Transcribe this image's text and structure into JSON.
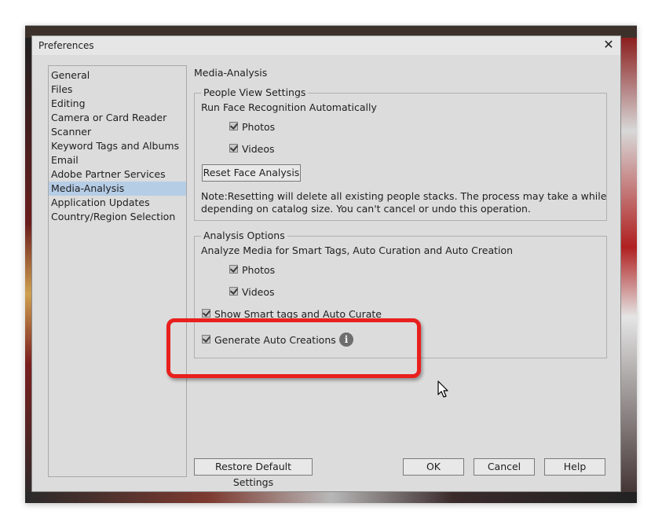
{
  "window": {
    "title": "Preferences",
    "close_glyph": "✕"
  },
  "sidebar": {
    "items": [
      {
        "label": "General"
      },
      {
        "label": "Files"
      },
      {
        "label": "Editing"
      },
      {
        "label": "Camera or Card Reader"
      },
      {
        "label": "Scanner"
      },
      {
        "label": "Keyword Tags and Albums"
      },
      {
        "label": "Email"
      },
      {
        "label": "Adobe Partner Services"
      },
      {
        "label": "Media-Analysis"
      },
      {
        "label": "Application Updates"
      },
      {
        "label": "Country/Region Selection"
      }
    ],
    "selected_index": 8
  },
  "page": {
    "heading": "Media-Analysis",
    "people_view": {
      "title": "People View Settings",
      "run_label": "Run Face Recognition Automatically",
      "photos_label": "Photos",
      "videos_label": "Videos",
      "reset_button": "Reset Face Analysis",
      "note_line1": "Note:Resetting will delete all existing people stacks. The process may take a while",
      "note_line2": "depending on catalog size. You can't cancel or undo this operation."
    },
    "analysis": {
      "title": "Analysis Options",
      "analyze_label": "Analyze Media for Smart Tags, Auto Curation and Auto Creation",
      "photos_label": "Photos",
      "videos_label": "Videos",
      "smart_tags_label": "Show Smart tags and Auto Curate",
      "auto_creations_label": "Generate Auto Creations",
      "info_glyph": "i"
    }
  },
  "footer": {
    "restore_button": "Restore Default Settings",
    "ok_button": "OK",
    "cancel_button": "Cancel",
    "help_button": "Help"
  },
  "colors": {
    "dialog_bg": "#dcdcdc",
    "selection": "#b6cde6",
    "highlight": "#e8201e"
  }
}
